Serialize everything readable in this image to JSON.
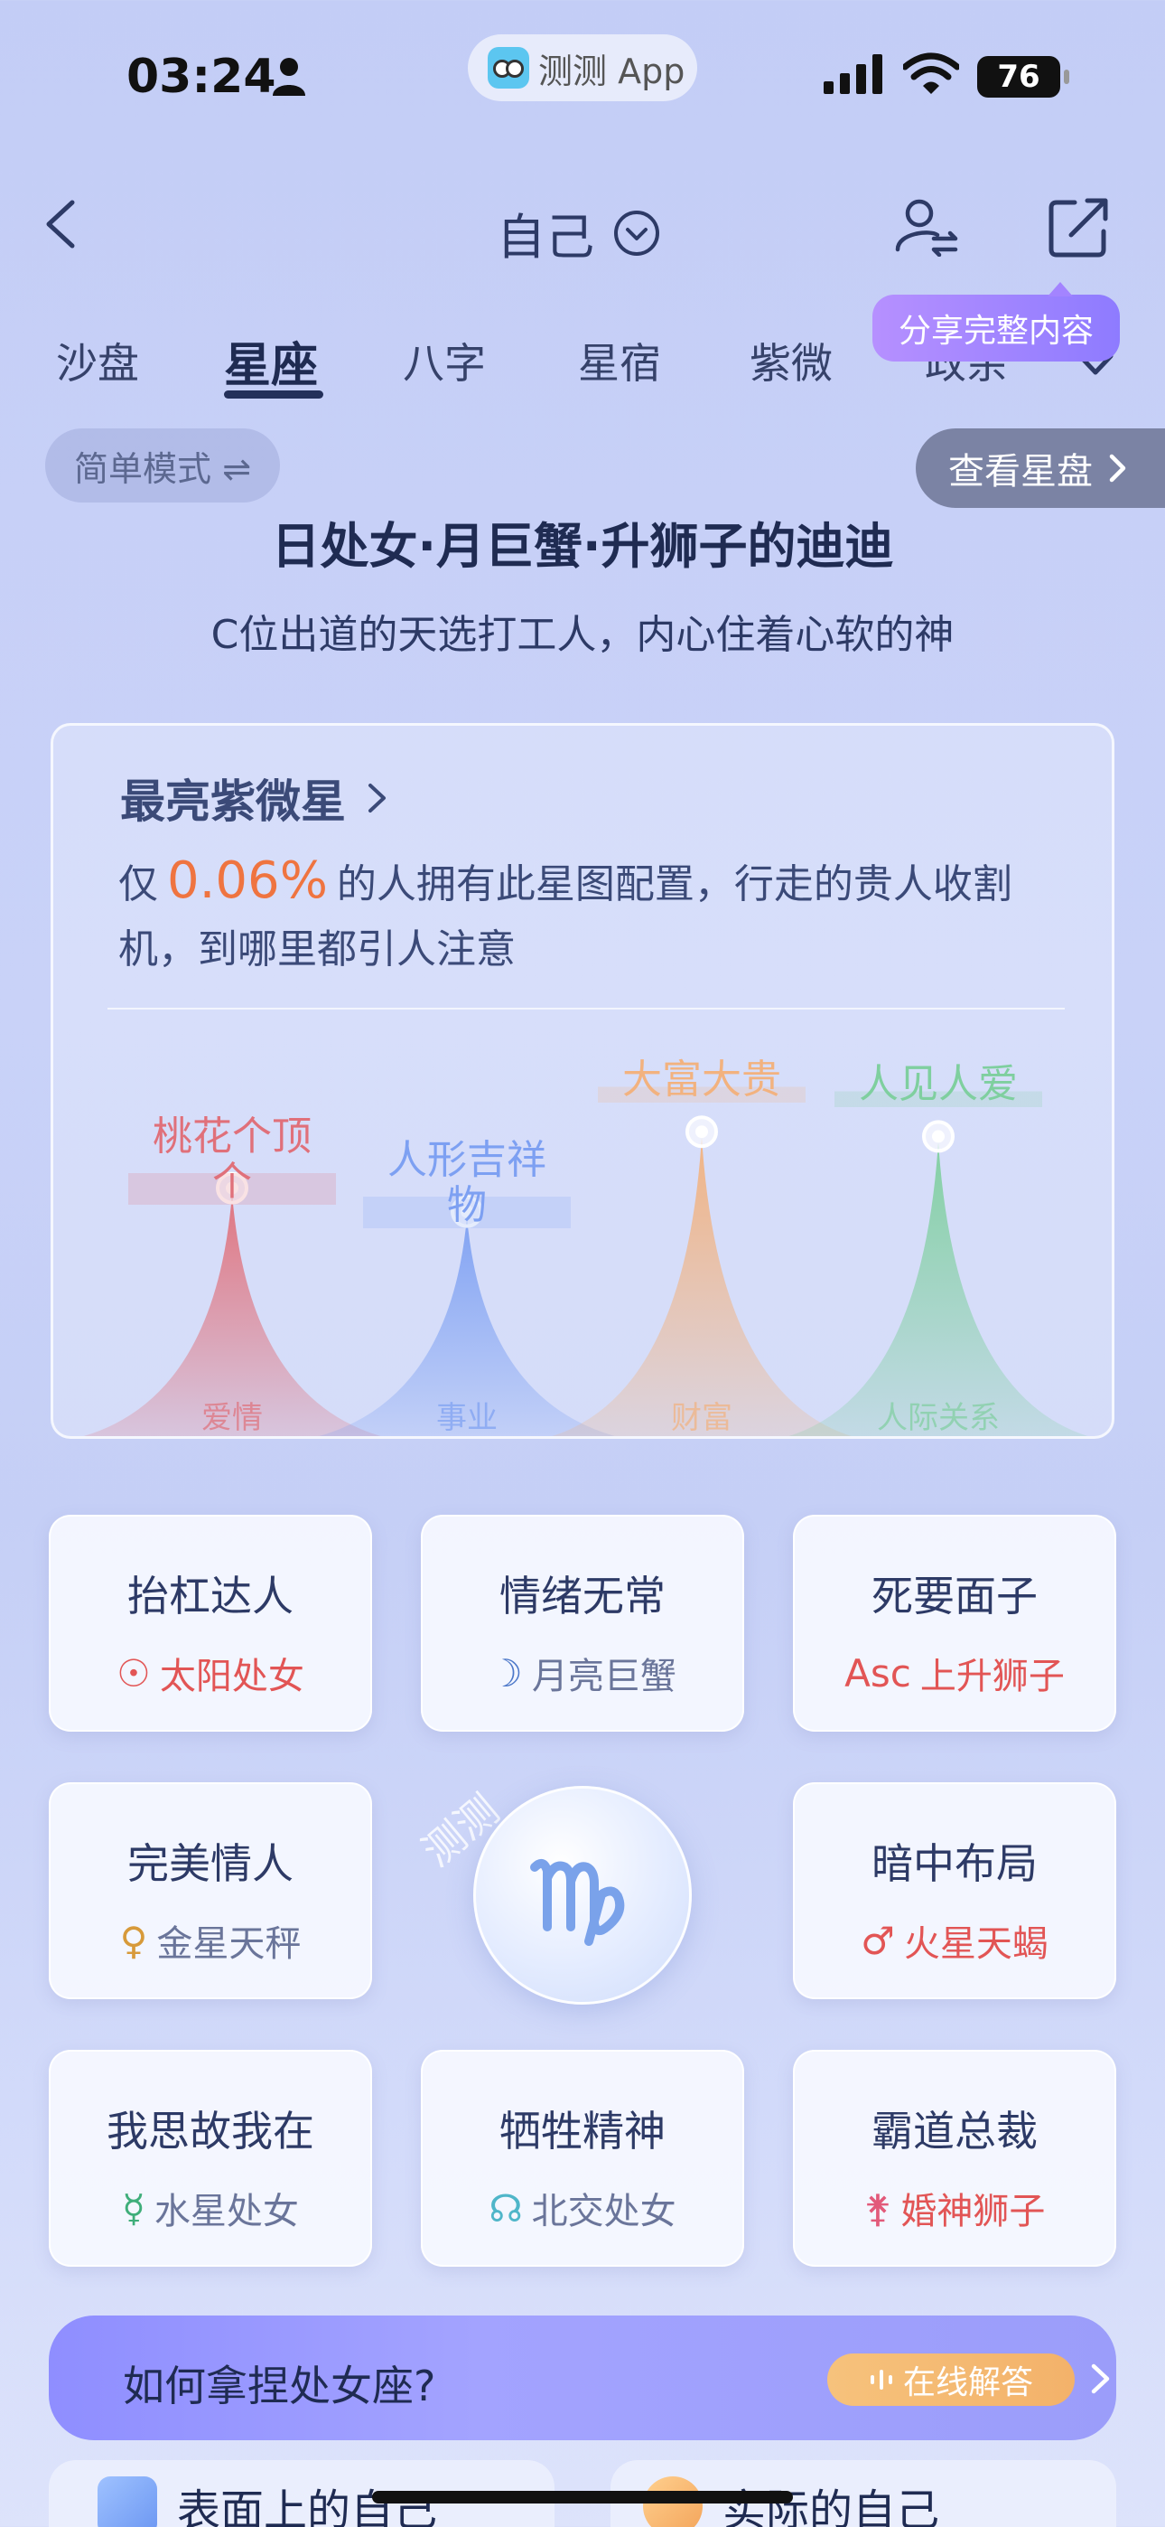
{
  "status": {
    "time": "03:24",
    "app_name": "测测 App",
    "battery": "76"
  },
  "header": {
    "title": "自己"
  },
  "tabs": [
    {
      "label": "沙盘"
    },
    {
      "label": "星座"
    },
    {
      "label": "八字"
    },
    {
      "label": "星宿"
    },
    {
      "label": "紫微"
    },
    {
      "label": "政余"
    }
  ],
  "share_bubble": "分享完整内容",
  "mode_label": "简单模式 ⇌",
  "view_chart_label": "查看星盘",
  "headline": "日处女·月巨蟹·升狮子的迪迪",
  "subline": "C位出道的天选打工人，内心住着心软的神",
  "stats_card": {
    "title": "最亮紫微星",
    "desc_prefix": "仅",
    "percent": "0.06%",
    "desc_suffix": "的人拥有此星图配置，行走的贵人收割机，到哪里都引人注意",
    "peaks": [
      {
        "tag": "桃花个顶个",
        "base": "爱情",
        "color": "#e0707a",
        "level": 0.72
      },
      {
        "tag": "人形吉祥物",
        "base": "事业",
        "color": "#7da0f2",
        "level": 0.67
      },
      {
        "tag": "大富大贵",
        "base": "财富",
        "color": "#f2b27f",
        "level": 0.84
      },
      {
        "tag": "人见人爱",
        "base": "人际关系",
        "color": "#7fcf9f",
        "level": 0.83
      }
    ]
  },
  "traits": [
    {
      "title": "抬杠达人",
      "symbol": "☉",
      "sub": "太阳处女",
      "color": "#e25555"
    },
    {
      "title": "情绪无常",
      "symbol": "☽",
      "sub": "月亮巨蟹",
      "color": "#4d78c9"
    },
    {
      "title": "死要面子",
      "symbol": "Asc",
      "sub": "上升狮子",
      "color": "#e25555"
    },
    {
      "title": "完美情人",
      "symbol": "♀",
      "sub": "金星天秤",
      "color": "#d79a3a"
    },
    {
      "title": "暗中布局",
      "symbol": "♂",
      "sub": "火星天蝎",
      "color": "#e25555"
    },
    {
      "title": "我思故我在",
      "symbol": "☿",
      "sub": "水星处女",
      "color": "#3fae7a"
    },
    {
      "title": "牺牲精神",
      "symbol": "☊",
      "sub": "北交处女",
      "color": "#4fb6c9"
    },
    {
      "title": "霸道总裁",
      "symbol": "⚵",
      "sub": "婚神狮子",
      "color": "#e25a7a"
    }
  ],
  "center_sign": {
    "glyph": "♍",
    "watermark": "测测"
  },
  "ask_banner": {
    "text": "如何拿捏处女座?",
    "online": "在线解答"
  },
  "bottom_cards": [
    {
      "label": "表面上的自己"
    },
    {
      "label": "实际的自己"
    }
  ],
  "colors": {
    "accent_orange": "#ef7440",
    "bubble_purple": "#a384ff"
  }
}
